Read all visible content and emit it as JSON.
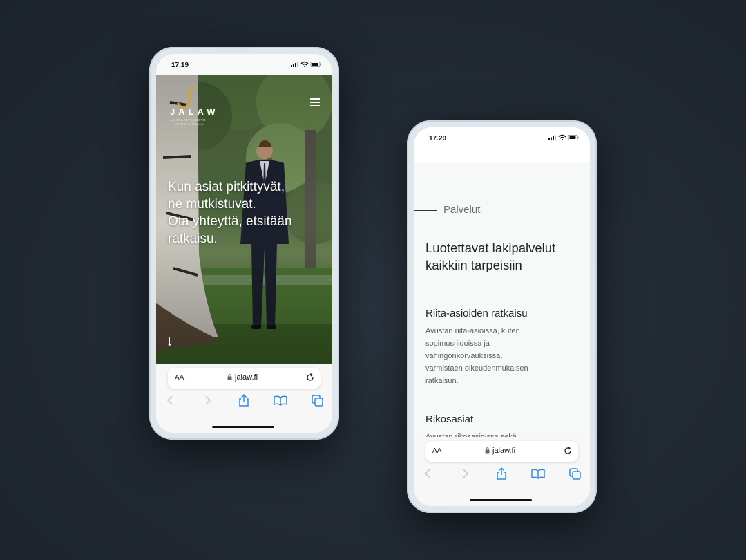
{
  "phone_left": {
    "status": {
      "time": "17.19"
    },
    "logo": {
      "name": "JALAW",
      "subtitle_line1": "ASIANAJOTOIMISTO",
      "subtitle_line2": "JARNO LAKKALA"
    },
    "hero": {
      "lines": [
        "Kun asiat pitkittyvät,",
        "ne mutkistuvat.",
        "Ota yhteyttä, etsitään",
        "ratkaisu."
      ],
      "arrow": "↓"
    },
    "browser": {
      "aa": "AA",
      "url": "jalaw.fi"
    }
  },
  "phone_right": {
    "status": {
      "time": "17.20"
    },
    "section_label": "Palvelut",
    "headline_lines": [
      "Luotettavat lakipalvelut",
      "kaikkiin tarpeisiin"
    ],
    "services": [
      {
        "title": "Riita-asioiden ratkaisu",
        "text_lines": [
          "Avustan riita-asioissa, kuten",
          "sopimusriidoissa ja",
          "vahingonkorvauksissa,",
          "varmistaen oikeudenmukaisen",
          "ratkaisun."
        ]
      },
      {
        "title": "Rikosasiat",
        "text_lines": [
          "Avustan rikosasioissa sekä"
        ]
      }
    ],
    "browser": {
      "aa": "AA",
      "url": "jalaw.fi"
    }
  },
  "colors": {
    "background": "#222a33",
    "accent_gold": "#c9a24a",
    "safari_blue": "#2f8be6"
  }
}
